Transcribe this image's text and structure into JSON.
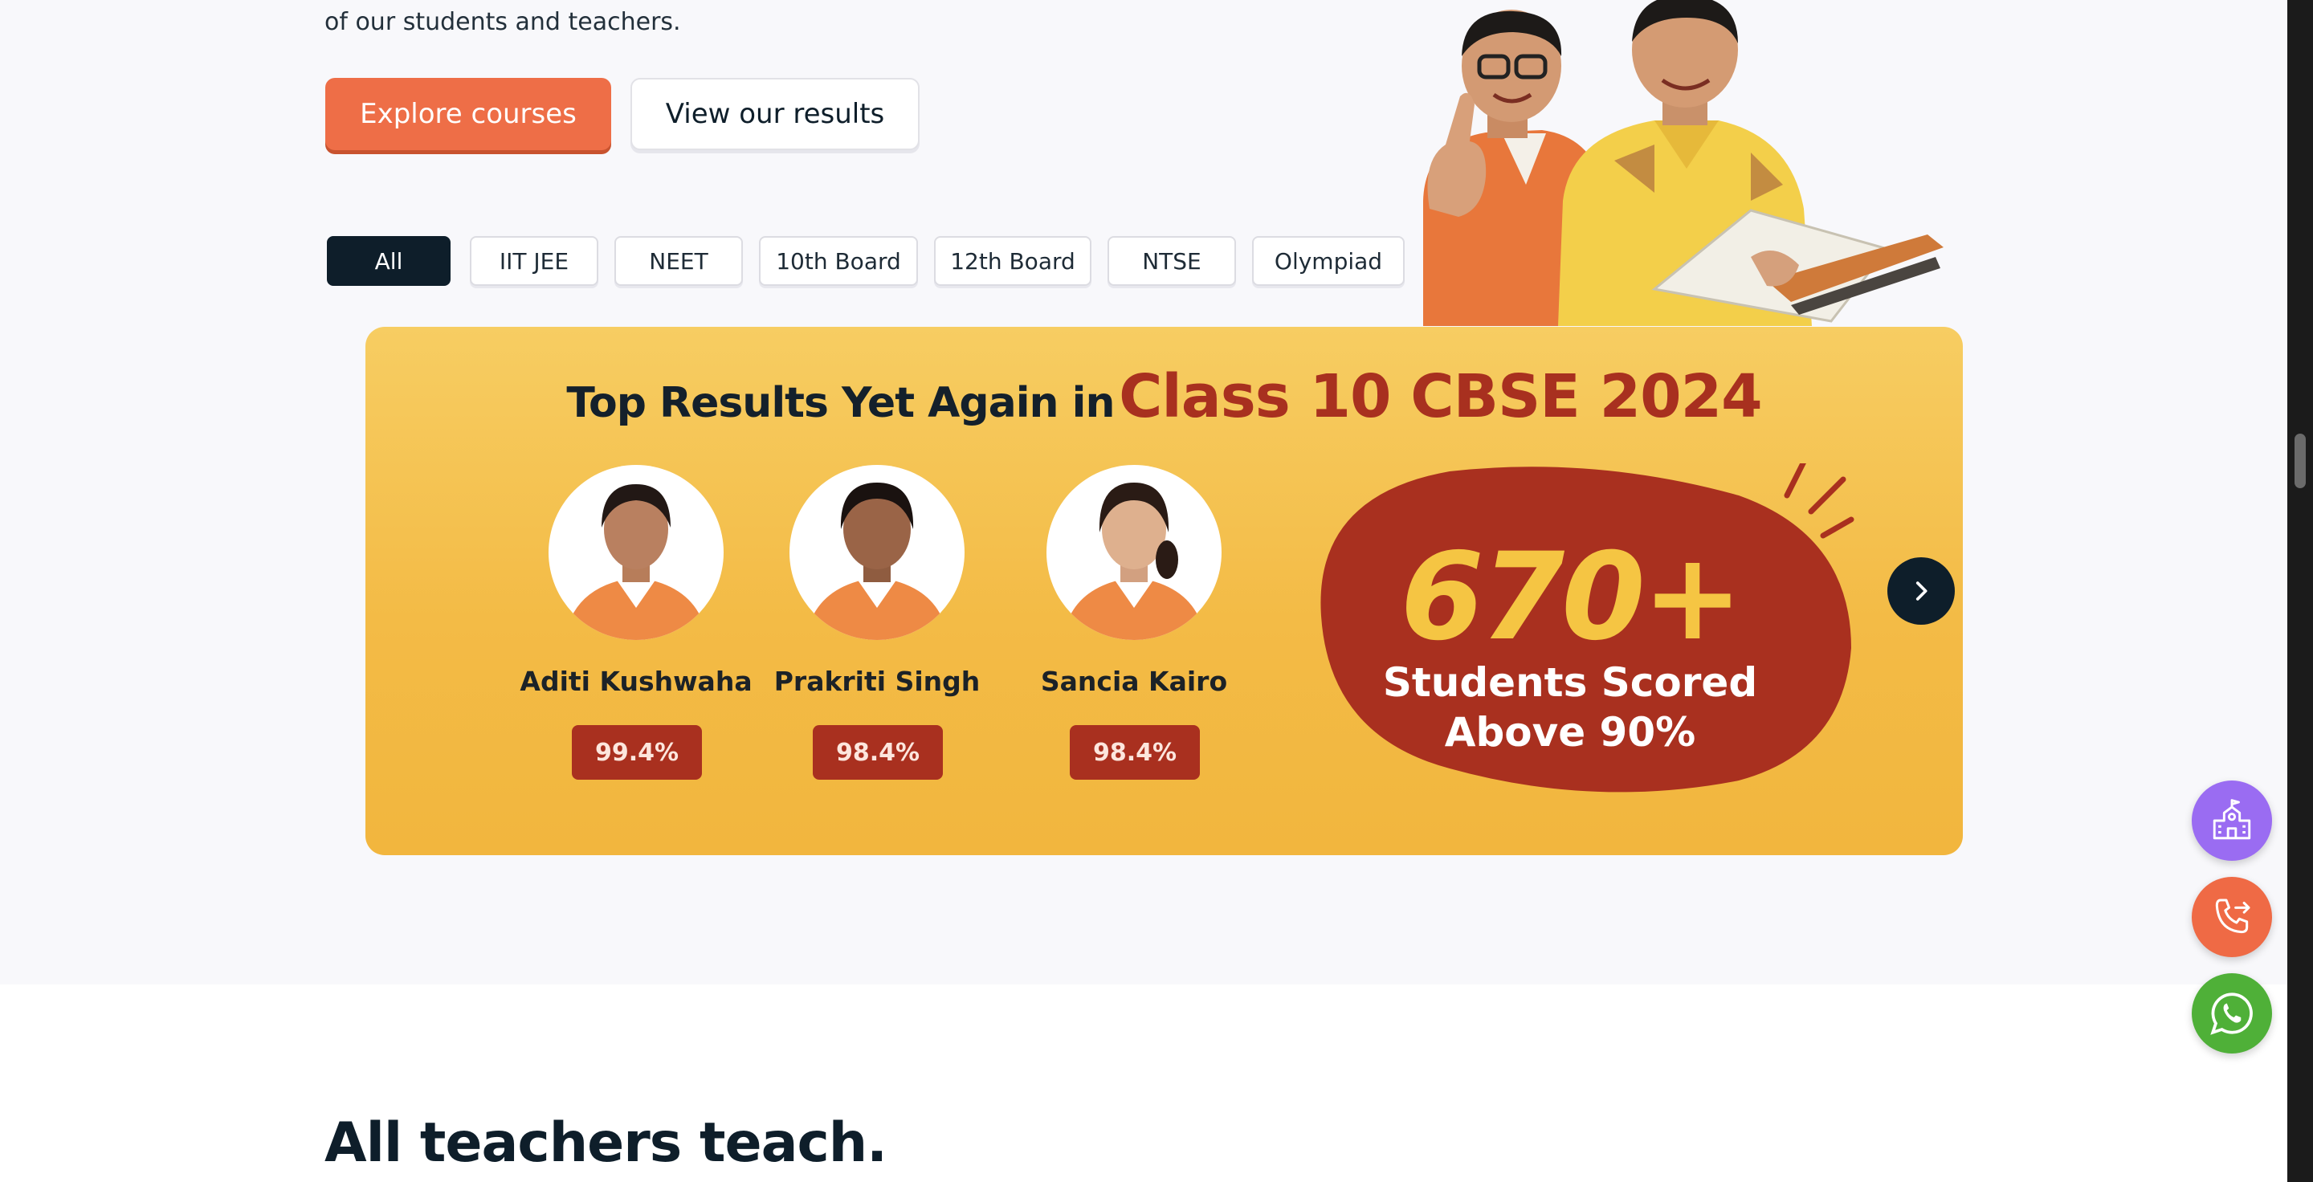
{
  "hero": {
    "intro_line": "of our students and teachers.",
    "buttons": {
      "primary_label": "Explore courses",
      "secondary_label": "View our results"
    }
  },
  "tabs": [
    {
      "label": "All",
      "active": true
    },
    {
      "label": "IIT JEE",
      "active": false
    },
    {
      "label": "NEET",
      "active": false
    },
    {
      "label": "10th Board",
      "active": false
    },
    {
      "label": "12th Board",
      "active": false
    },
    {
      "label": "NTSE",
      "active": false
    },
    {
      "label": "Olympiad",
      "active": false
    }
  ],
  "banner": {
    "title_prefix": "Top Results Yet Again in",
    "title_highlight": "Class 10 CBSE 2024",
    "students": [
      {
        "name": "Aditi Kushwaha",
        "score": "99.4%"
      },
      {
        "name": "Prakriti Singh",
        "score": "98.4%"
      },
      {
        "name": "Sancia Kairo",
        "score": "98.4%"
      }
    ],
    "stat_number": "670+",
    "stat_line1": "Students Scored",
    "stat_line2": "Above 90%"
  },
  "section": {
    "title": "All teachers teach."
  },
  "floating_actions": [
    {
      "icon": "school-icon",
      "color": "#9a6cf2"
    },
    {
      "icon": "phone-callback-icon",
      "color": "#ef6a45"
    },
    {
      "icon": "whatsapp-icon",
      "color": "#4fb038"
    }
  ],
  "colors": {
    "accent": "#ee6e47",
    "dark": "#0e1e2a",
    "banner_yellow": "#f3bb46",
    "banner_red": "#a9301f"
  }
}
